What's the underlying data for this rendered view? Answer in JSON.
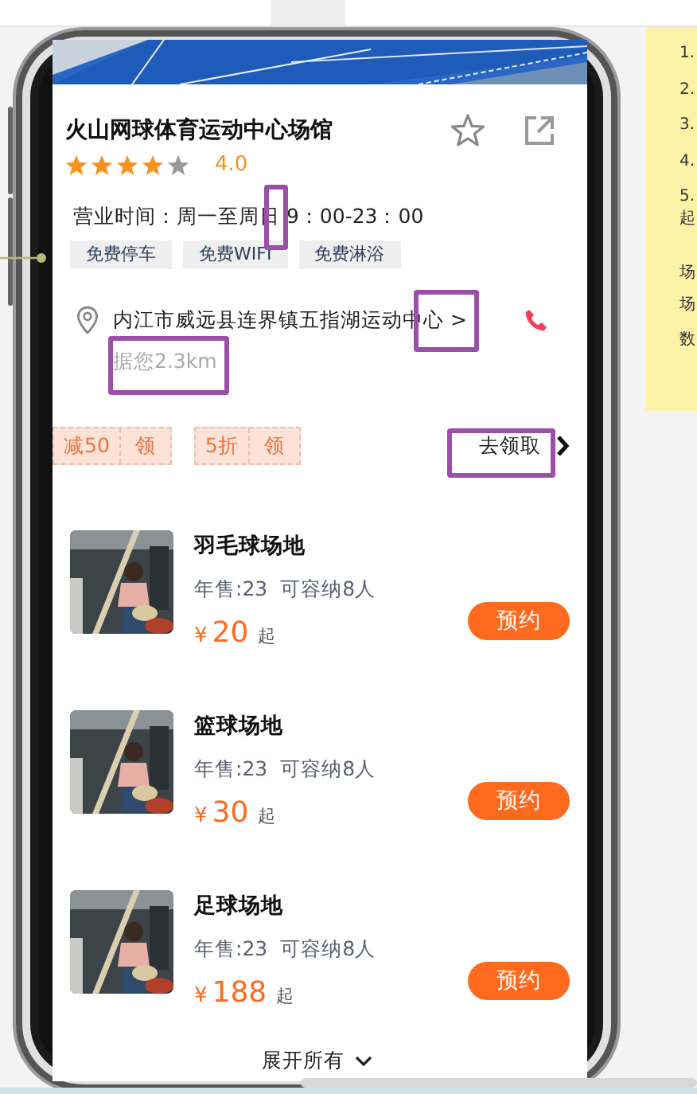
{
  "venue": {
    "name": "火山网球体育运动中心场馆",
    "stars": 4,
    "rating": "4.0"
  },
  "hours": "营业时间：周一至周日 9：00-23：00",
  "amenities": [
    "免费停车",
    "免费WIFI",
    "免费淋浴"
  ],
  "address": "内江市威远县连界镇五指湖运动中心 >",
  "distance": "据您2.3km",
  "coupons": [
    {
      "offer": "减50",
      "action": "领"
    },
    {
      "offer": "5折",
      "action": "领"
    }
  ],
  "coupon_link": "去领取",
  "courts": [
    {
      "name": "羽毛球场地",
      "sales": "年售:23",
      "capacity": "可容纳8人",
      "currency": "¥",
      "price": "20",
      "unit": "起",
      "button": "预约"
    },
    {
      "name": "篮球场地",
      "sales": "年售:23",
      "capacity": "可容纳8人",
      "currency": "¥",
      "price": "30",
      "unit": "起",
      "button": "预约"
    },
    {
      "name": "足球场地",
      "sales": "年售:23",
      "capacity": "可容纳8人",
      "currency": "¥",
      "price": "188",
      "unit": "起",
      "button": "预约"
    }
  ],
  "expand": "展开所有",
  "note_lines": [
    "1.",
    "2.",
    "3.",
    "4.",
    "5.",
    "起",
    "场",
    "场",
    "数"
  ],
  "review_marks": [
    {
      "kind": "box"
    },
    {
      "kind": "box"
    },
    {
      "kind": "box"
    },
    {
      "kind": "box"
    },
    {
      "kind": "pin"
    }
  ]
}
